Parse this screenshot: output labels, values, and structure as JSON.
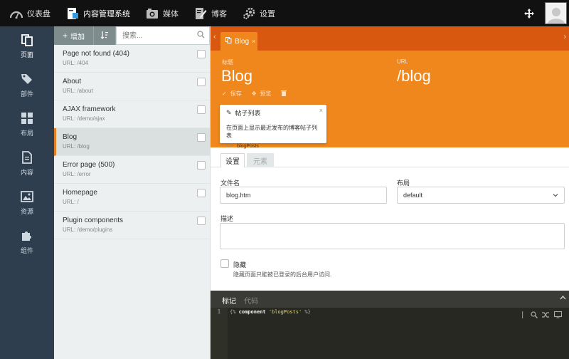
{
  "topnav": {
    "items": [
      {
        "label": "仪表盘",
        "icon": "dashboard-icon"
      },
      {
        "label": "内容管理系统",
        "icon": "cms-icon",
        "active": true
      },
      {
        "label": "媒体",
        "icon": "media-icon"
      },
      {
        "label": "博客",
        "icon": "blog-icon"
      },
      {
        "label": "设置",
        "icon": "settings-gear-icon"
      }
    ]
  },
  "sidebar": {
    "items": [
      {
        "label": "页面",
        "icon": "pages-icon",
        "active": true
      },
      {
        "label": "部件",
        "icon": "partials-tag-icon"
      },
      {
        "label": "布局",
        "icon": "layouts-grid-icon"
      },
      {
        "label": "内容",
        "icon": "content-file-icon"
      },
      {
        "label": "资源",
        "icon": "assets-image-icon"
      },
      {
        "label": "组件",
        "icon": "components-puzzle-icon"
      }
    ]
  },
  "list": {
    "add_label": "增加",
    "search_placeholder": "搜索...",
    "pages": [
      {
        "title": "Page not found (404)",
        "url": "URL: /404"
      },
      {
        "title": "About",
        "url": "URL: /about"
      },
      {
        "title": "AJAX framework",
        "url": "URL: /demo/ajax"
      },
      {
        "title": "Blog",
        "url": "URL: /blog",
        "selected": true
      },
      {
        "title": "Error page (500)",
        "url": "URL: /error"
      },
      {
        "title": "Homepage",
        "url": "URL: /"
      },
      {
        "title": "Plugin components",
        "url": "URL: /demo/plugins"
      }
    ]
  },
  "editor": {
    "tab_label": "Blog",
    "title_label": "标题",
    "title_value": "Blog",
    "url_label": "URL",
    "url_value": "/blog",
    "actions": {
      "save": "保存",
      "preview": "预览"
    },
    "tooltip": {
      "title": "帖子列表",
      "description": "在页面上显示最近发布的博客帖子列表",
      "code": "blogPosts"
    },
    "subtabs": {
      "settings": "设置",
      "elements": "元素"
    },
    "fields": {
      "filename_label": "文件名",
      "filename_value": "blog.htm",
      "layout_label": "布局",
      "layout_value": "default",
      "description_label": "描述",
      "hidden_label": "隐藏",
      "hidden_help": "隐藏页面只能被已登录的后台用户访问."
    },
    "code_tabs": {
      "markup": "标记",
      "code": "代码"
    },
    "code": {
      "line_number": "1",
      "open": "{%",
      "keyword": "component",
      "string": "'blogPosts'",
      "close": "%}"
    }
  },
  "colors": {
    "accent_orange": "#f0871d",
    "tabstrip_orange": "#d9580f",
    "sidebar": "#2e3e4f",
    "topbar": "#111111"
  }
}
